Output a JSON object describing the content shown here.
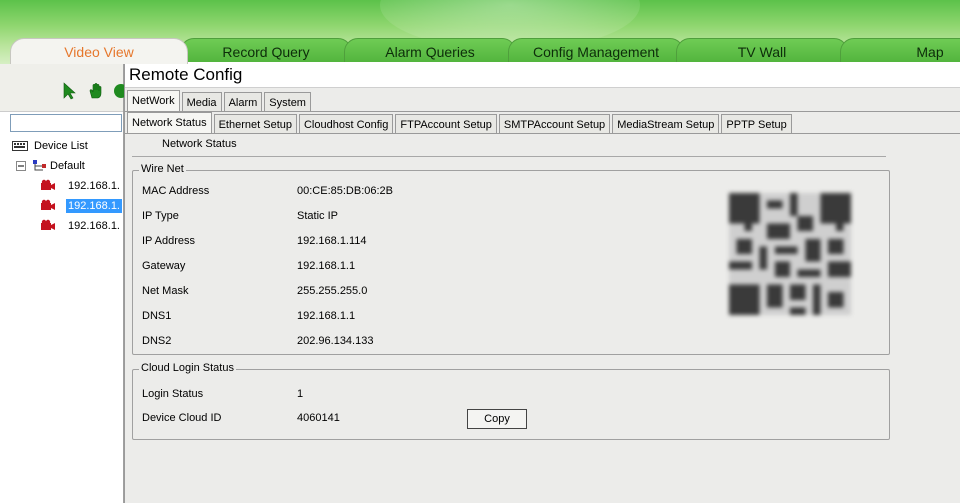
{
  "main_tabs": [
    {
      "label": "Video View",
      "active": true
    },
    {
      "label": "Record Query",
      "active": false
    },
    {
      "label": "Alarm Queries",
      "active": false
    },
    {
      "label": "Config Management",
      "active": false
    },
    {
      "label": "TV Wall",
      "active": false
    },
    {
      "label": "Map",
      "active": false
    }
  ],
  "left_pane": {
    "tools": [
      "select-arrow-icon",
      "hand-icon",
      "refresh-icon"
    ],
    "tree": {
      "root": "Device List",
      "group": "Default",
      "devices": [
        "192.168.1.",
        "192.168.1.",
        "192.168.1."
      ],
      "selected_index": 1
    }
  },
  "dialog": {
    "title": "Remote Config",
    "tabs": [
      "NetWork",
      "Media",
      "Alarm",
      "System"
    ],
    "subtabs": [
      "Network Status",
      "Ethernet Setup",
      "Cloudhost Config",
      "FTPAccount Setup",
      "SMTPAccount Setup",
      "MediaStream Setup",
      "PPTP Setup"
    ],
    "section_caption": "Network Status",
    "wire_net": {
      "legend": "Wire Net",
      "fields": [
        {
          "label": "MAC Address",
          "value": "00:CE:85:DB:06:2B"
        },
        {
          "label": "IP Type",
          "value": "Static IP"
        },
        {
          "label": "IP Address",
          "value": "192.168.1.114"
        },
        {
          "label": "Gateway",
          "value": "192.168.1.1"
        },
        {
          "label": "Net Mask",
          "value": "255.255.255.0"
        },
        {
          "label": "DNS1",
          "value": "192.168.1.1"
        },
        {
          "label": "DNS2",
          "value": "202.96.134.133"
        }
      ]
    },
    "cloud": {
      "legend": "Cloud Login Status",
      "login_status_label": "Login Status",
      "login_status_value": "1",
      "device_id_label": "Device Cloud ID",
      "device_id_value": "4060141",
      "copy_label": "Copy"
    }
  },
  "colors": {
    "header_green": "#5cc24a",
    "active_tab_text": "#e6772c",
    "selection": "#3399ff"
  }
}
